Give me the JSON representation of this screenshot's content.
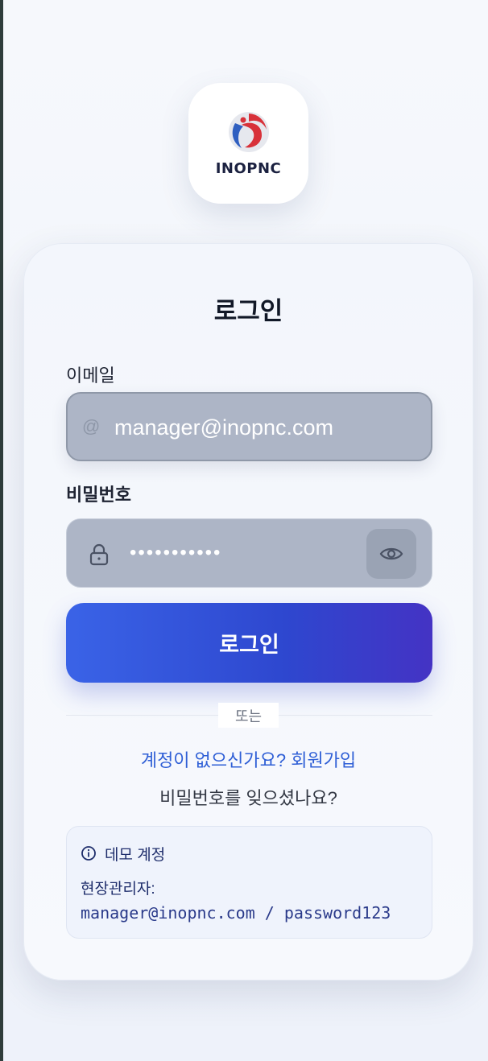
{
  "brand": {
    "name": "INOPNC",
    "logo_icon": "inopnc-logo-icon"
  },
  "login_form": {
    "title": "로그인",
    "email_label": "이메일",
    "email_value": "manager@inopnc.com",
    "email_icon": "at-sign-icon",
    "password_label": "비밀번호",
    "password_value": "•••••••••••",
    "password_icon": "lock-icon",
    "toggle_visibility_icon": "eye-icon",
    "submit_label": "로그인"
  },
  "divider_text": "또는",
  "links": {
    "signup": "계정이 없으신가요? 회원가입",
    "forgot_password": "비밀번호를 잊으셨나요?"
  },
  "demo_account": {
    "icon": "info-icon",
    "title": "데모 계정",
    "role": "현장관리자:",
    "credentials": "manager@inopnc.com / password123"
  },
  "colors": {
    "primary_start": "#3a63e7",
    "primary_end": "#4433c4",
    "link": "#2f5fd6",
    "input_background": "#adb5c6"
  }
}
